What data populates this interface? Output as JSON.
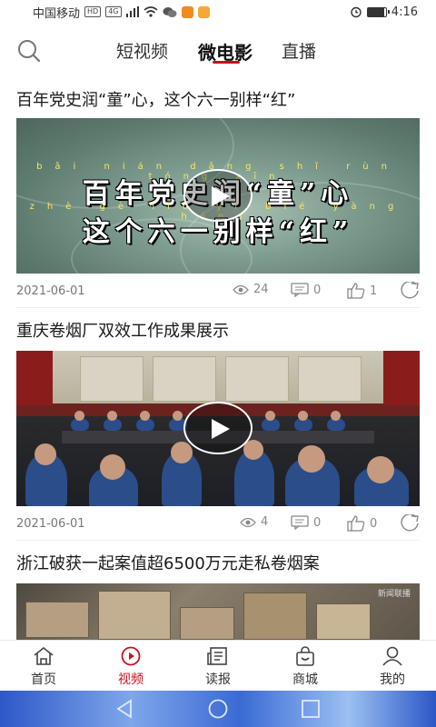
{
  "status_bar": {
    "carrier": "中国移动",
    "network_badges": [
      "HD",
      "4G"
    ],
    "time": "4:16",
    "battery_level": 0.9
  },
  "top_nav": {
    "search_icon": "search-icon",
    "tabs": [
      {
        "label": "短视频",
        "active": false
      },
      {
        "label": "微电影",
        "active": true
      },
      {
        "label": "直播",
        "active": false
      }
    ]
  },
  "feed": {
    "items": [
      {
        "title": "百年党史润“童”心，这个六一别样“红”",
        "thumbnail_text": {
          "pinyin_line1": "bǎi nián dǎng shǐ rùn tóng xīn",
          "line1": "百年党史润“童”心",
          "pinyin_line2": "zhè gè liù yī bié yàng hóng",
          "line2": "这个六一别样“红”"
        },
        "date": "2021-06-01",
        "views": "24",
        "comments": "0",
        "likes": "1"
      },
      {
        "title": "重庆卷烟厂双效工作成果展示",
        "date": "2021-06-01",
        "views": "4",
        "comments": "0",
        "likes": "0"
      },
      {
        "title": "浙江破获一起案值超6500万元走私卷烟案",
        "thumbnail_watermark": "新闻联播"
      }
    ]
  },
  "bottom_tabs": [
    {
      "label": "首页",
      "icon": "home-icon",
      "active": false
    },
    {
      "label": "视频",
      "icon": "video-play-icon",
      "active": true
    },
    {
      "label": "读报",
      "icon": "newspaper-icon",
      "active": false
    },
    {
      "label": "商城",
      "icon": "shopping-bag-icon",
      "active": false
    },
    {
      "label": "我的",
      "icon": "user-icon",
      "active": false
    }
  ],
  "colors": {
    "accent": "#c8101e",
    "text": "#222222",
    "muted": "#888888"
  }
}
